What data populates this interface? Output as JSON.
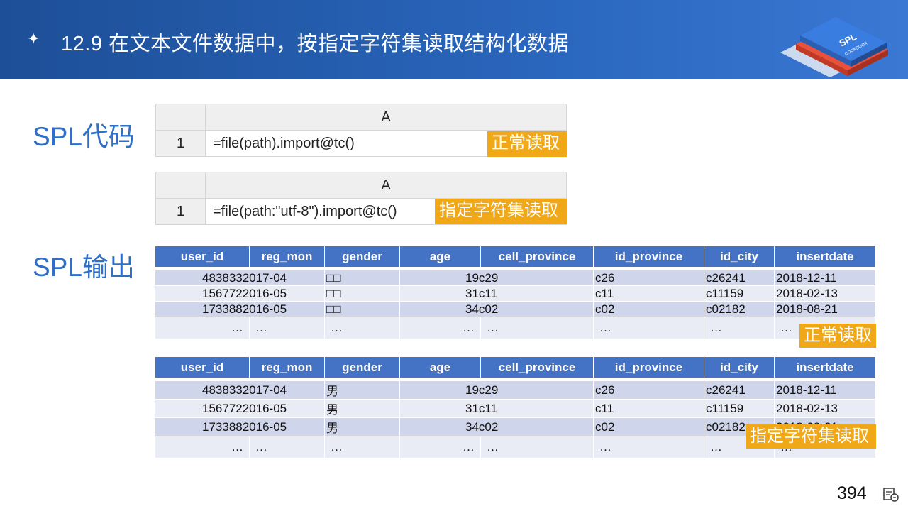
{
  "header": {
    "bullet": "✦",
    "title": "12.9 在文本文件数据中，按指定字符集读取结构化数据"
  },
  "labels": {
    "code": "SPL代码",
    "output": "SPL输出"
  },
  "code1": {
    "col": "A",
    "row": "1",
    "expr": "=file(path).import@tc()",
    "tag": "正常读取"
  },
  "code2": {
    "col": "A",
    "row": "1",
    "expr": "=file(path:\"utf-8\").import@tc()",
    "tag": "指定字符集读取"
  },
  "columns": [
    "user_id",
    "reg_mon",
    "gender",
    "age",
    "cell_province",
    "id_province",
    "id_city",
    "insertdate"
  ],
  "table1": {
    "rows": [
      [
        "4838332017-04",
        "□□",
        "19c29",
        "c26",
        "c26241",
        "2018-12-11"
      ],
      [
        "1567722016-05",
        "□□",
        "31c11",
        "c11",
        "c11159",
        "2018-02-13"
      ],
      [
        "1733882016-05",
        "□□",
        "34c02",
        "c02",
        "c02182",
        "2018-08-21"
      ]
    ],
    "tag": "正常读取"
  },
  "table2": {
    "rows": [
      [
        "4838332017-04",
        "男",
        "19c29",
        "c26",
        "c26241",
        "2018-12-11"
      ],
      [
        "1567722016-05",
        "男",
        "31c11",
        "c11",
        "c11159",
        "2018-02-13"
      ],
      [
        "1733882016-05",
        "男",
        "34c02",
        "c02",
        "c02182",
        "2018-08-21"
      ]
    ],
    "tag": "指定字符集读取"
  },
  "ellipsis": "…",
  "page_number": "394",
  "logo_text": {
    "main": "SPL",
    "sub": "COOKBOOK"
  },
  "colors": {
    "header": "#2a66bd",
    "accent": "#2f6fc7",
    "tag": "#f0a818",
    "table_head": "#4473c5"
  }
}
